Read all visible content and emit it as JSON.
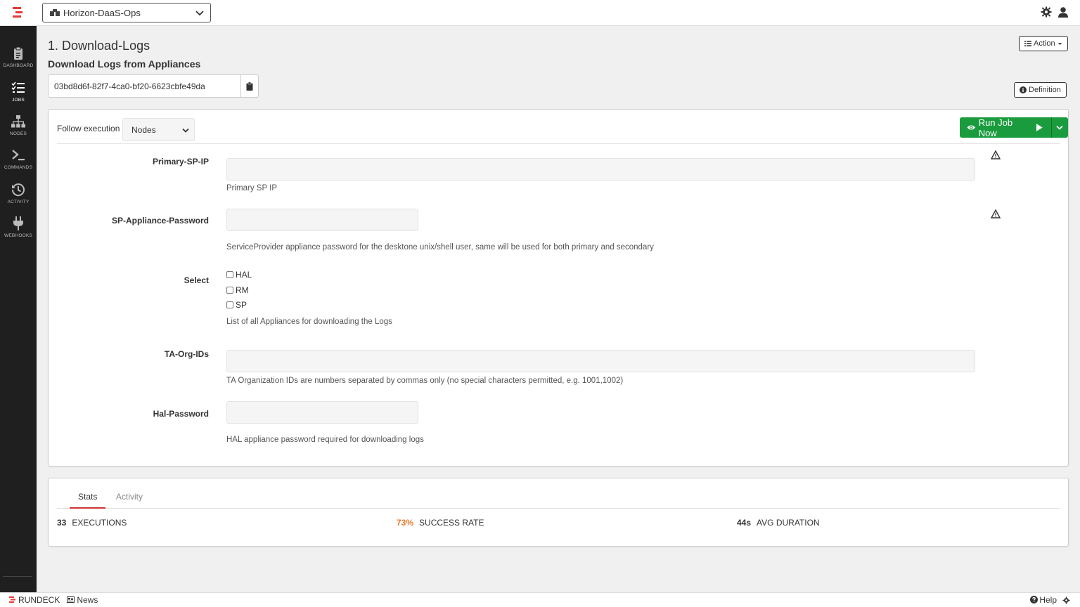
{
  "app": {
    "name": "RUNDECK"
  },
  "topbar": {
    "project": "Horizon-DaaS-Ops"
  },
  "sidebar": {
    "items": [
      {
        "label": "DASHBOARD",
        "icon": "clipboard-icon"
      },
      {
        "label": "JOBS",
        "icon": "list-icon",
        "active": true
      },
      {
        "label": "NODES",
        "icon": "sitemap-icon"
      },
      {
        "label": "COMMANDS",
        "icon": "terminal-icon"
      },
      {
        "label": "ACTIVITY",
        "icon": "history-icon"
      },
      {
        "label": "WEBHOOKS",
        "icon": "plug-icon"
      }
    ]
  },
  "job": {
    "title": "1. Download-Logs",
    "description": "Download Logs from Appliances",
    "uuid": "03bd8d6f-82f7-4ca0-bf20-6623cbfe49da",
    "action_label": "Action",
    "definition_label": "Definition"
  },
  "execution": {
    "follow_label": "Follow execution",
    "follow_value": "Nodes",
    "run_label": "Run Job Now"
  },
  "options": [
    {
      "label": "Primary-SP-IP",
      "value": "",
      "help": "Primary SP IP"
    },
    {
      "label": "SP-Appliance-Password",
      "value": "",
      "help": "ServiceProvider appliance password for the desktone unix/shell user, same will be used for both primary and secondary"
    },
    {
      "label": "Select",
      "choices": [
        "HAL",
        "RM",
        "SP"
      ],
      "help": "List of all Appliances for downloading the Logs"
    },
    {
      "label": "TA-Org-IDs",
      "value": "",
      "help": "TA Organization IDs are numbers separated by commas only (no special characters permitted, e.g. 1001,1002)"
    },
    {
      "label": "Hal-Password",
      "value": "",
      "help": "HAL appliance password required for downloading logs"
    }
  ],
  "stats": {
    "tabs": [
      "Stats",
      "Activity"
    ],
    "executions": {
      "value": "33",
      "label": "EXECUTIONS"
    },
    "success_rate": {
      "value": "73%",
      "label": "SUCCESS RATE"
    },
    "avg_duration": {
      "value": "44s",
      "label": "AVG DURATION"
    }
  },
  "footer": {
    "brand": "RUNDECK",
    "news": "News",
    "help": "Help"
  },
  "colors": {
    "accent_red": "#e53935",
    "run_green": "#1a9c3e",
    "sidebar_bg": "#1f1f1f",
    "success_orange": "#e97b2c"
  }
}
